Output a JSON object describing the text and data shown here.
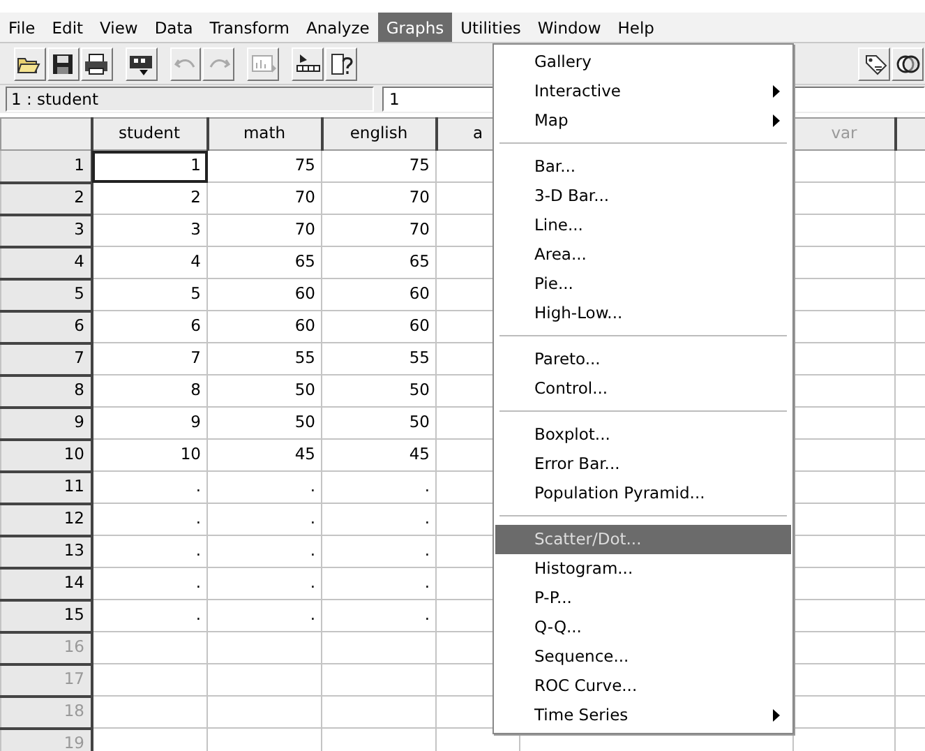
{
  "menubar": [
    {
      "label": "File",
      "selected": false
    },
    {
      "label": "Edit",
      "selected": false
    },
    {
      "label": "View",
      "selected": false
    },
    {
      "label": "Data",
      "selected": false
    },
    {
      "label": "Transform",
      "selected": false
    },
    {
      "label": "Analyze",
      "selected": false
    },
    {
      "label": "Graphs",
      "selected": true
    },
    {
      "label": "Utilities",
      "selected": false
    },
    {
      "label": "Window",
      "selected": false
    },
    {
      "label": "Help",
      "selected": false
    }
  ],
  "toolbar": [
    {
      "kind": "open",
      "disabled": false
    },
    {
      "kind": "save",
      "disabled": false
    },
    {
      "kind": "print",
      "disabled": false
    },
    {
      "kind": "dialog",
      "disabled": false
    },
    {
      "kind": "undo",
      "disabled": true
    },
    {
      "kind": "redo",
      "disabled": true
    },
    {
      "kind": "chart",
      "disabled": true
    },
    {
      "kind": "insert",
      "disabled": false
    },
    {
      "kind": "help",
      "disabled": false
    },
    {
      "kind": "tag",
      "disabled": false
    },
    {
      "kind": "circles",
      "disabled": false
    }
  ],
  "cell_editor": {
    "cell": "1 : student",
    "value": "1"
  },
  "grid": {
    "columns": [
      {
        "label": "student",
        "defined": true
      },
      {
        "label": "math",
        "defined": true
      },
      {
        "label": "english",
        "defined": true
      },
      {
        "label": "a",
        "defined": true
      },
      {
        "label": "var",
        "defined": false
      }
    ],
    "rows": [
      {
        "number": "1",
        "in_use": true,
        "cells": [
          {
            "text": "1",
            "selected": true
          },
          {
            "text": "75",
            "selected": false
          },
          {
            "text": "75",
            "selected": false
          }
        ]
      },
      {
        "number": "2",
        "in_use": true,
        "cells": [
          {
            "text": "2",
            "selected": false
          },
          {
            "text": "70",
            "selected": false
          },
          {
            "text": "70",
            "selected": false
          }
        ]
      },
      {
        "number": "3",
        "in_use": true,
        "cells": [
          {
            "text": "3",
            "selected": false
          },
          {
            "text": "70",
            "selected": false
          },
          {
            "text": "70",
            "selected": false
          }
        ]
      },
      {
        "number": "4",
        "in_use": true,
        "cells": [
          {
            "text": "4",
            "selected": false
          },
          {
            "text": "65",
            "selected": false
          },
          {
            "text": "65",
            "selected": false
          }
        ]
      },
      {
        "number": "5",
        "in_use": true,
        "cells": [
          {
            "text": "5",
            "selected": false
          },
          {
            "text": "60",
            "selected": false
          },
          {
            "text": "60",
            "selected": false
          }
        ]
      },
      {
        "number": "6",
        "in_use": true,
        "cells": [
          {
            "text": "6",
            "selected": false
          },
          {
            "text": "60",
            "selected": false
          },
          {
            "text": "60",
            "selected": false
          }
        ]
      },
      {
        "number": "7",
        "in_use": true,
        "cells": [
          {
            "text": "7",
            "selected": false
          },
          {
            "text": "55",
            "selected": false
          },
          {
            "text": "55",
            "selected": false
          }
        ]
      },
      {
        "number": "8",
        "in_use": true,
        "cells": [
          {
            "text": "8",
            "selected": false
          },
          {
            "text": "50",
            "selected": false
          },
          {
            "text": "50",
            "selected": false
          }
        ]
      },
      {
        "number": "9",
        "in_use": true,
        "cells": [
          {
            "text": "9",
            "selected": false
          },
          {
            "text": "50",
            "selected": false
          },
          {
            "text": "50",
            "selected": false
          }
        ]
      },
      {
        "number": "10",
        "in_use": true,
        "cells": [
          {
            "text": "10",
            "selected": false
          },
          {
            "text": "45",
            "selected": false
          },
          {
            "text": "45",
            "selected": false
          }
        ]
      },
      {
        "number": "11",
        "in_use": true,
        "cells": [
          {
            "text": ".",
            "selected": false
          },
          {
            "text": ".",
            "selected": false
          },
          {
            "text": ".",
            "selected": false
          }
        ]
      },
      {
        "number": "12",
        "in_use": true,
        "cells": [
          {
            "text": ".",
            "selected": false
          },
          {
            "text": ".",
            "selected": false
          },
          {
            "text": ".",
            "selected": false
          }
        ]
      },
      {
        "number": "13",
        "in_use": true,
        "cells": [
          {
            "text": ".",
            "selected": false
          },
          {
            "text": ".",
            "selected": false
          },
          {
            "text": ".",
            "selected": false
          }
        ]
      },
      {
        "number": "14",
        "in_use": true,
        "cells": [
          {
            "text": ".",
            "selected": false
          },
          {
            "text": ".",
            "selected": false
          },
          {
            "text": ".",
            "selected": false
          }
        ]
      },
      {
        "number": "15",
        "in_use": true,
        "cells": [
          {
            "text": ".",
            "selected": false
          },
          {
            "text": ".",
            "selected": false
          },
          {
            "text": ".",
            "selected": false
          }
        ]
      },
      {
        "number": "16",
        "in_use": false
      },
      {
        "number": "17",
        "in_use": false
      },
      {
        "number": "18",
        "in_use": false
      },
      {
        "number": "19",
        "in_use": false
      }
    ]
  },
  "graphs_menu": [
    {
      "kind": "item",
      "label": "Gallery",
      "submenu": false,
      "selected": false
    },
    {
      "kind": "item",
      "label": "Interactive",
      "submenu": true,
      "selected": false
    },
    {
      "kind": "item",
      "label": "Map",
      "submenu": true,
      "selected": false
    },
    {
      "kind": "separator"
    },
    {
      "kind": "item",
      "label": "Bar...",
      "submenu": false,
      "selected": false
    },
    {
      "kind": "item",
      "label": "3-D Bar...",
      "submenu": false,
      "selected": false
    },
    {
      "kind": "item",
      "label": "Line...",
      "submenu": false,
      "selected": false
    },
    {
      "kind": "item",
      "label": "Area...",
      "submenu": false,
      "selected": false
    },
    {
      "kind": "item",
      "label": "Pie...",
      "submenu": false,
      "selected": false
    },
    {
      "kind": "item",
      "label": "High-Low...",
      "submenu": false,
      "selected": false
    },
    {
      "kind": "separator"
    },
    {
      "kind": "item",
      "label": "Pareto...",
      "submenu": false,
      "selected": false
    },
    {
      "kind": "item",
      "label": "Control...",
      "submenu": false,
      "selected": false
    },
    {
      "kind": "separator"
    },
    {
      "kind": "item",
      "label": "Boxplot...",
      "submenu": false,
      "selected": false
    },
    {
      "kind": "item",
      "label": "Error Bar...",
      "submenu": false,
      "selected": false
    },
    {
      "kind": "item",
      "label": "Population Pyramid...",
      "submenu": false,
      "selected": false
    },
    {
      "kind": "separator"
    },
    {
      "kind": "item",
      "label": "Scatter/Dot...",
      "submenu": false,
      "selected": true
    },
    {
      "kind": "item",
      "label": "Histogram...",
      "submenu": false,
      "selected": false
    },
    {
      "kind": "item",
      "label": "P-P...",
      "submenu": false,
      "selected": false
    },
    {
      "kind": "item",
      "label": "Q-Q...",
      "submenu": false,
      "selected": false
    },
    {
      "kind": "item",
      "label": "Sequence...",
      "submenu": false,
      "selected": false
    },
    {
      "kind": "item",
      "label": "ROC Curve...",
      "submenu": false,
      "selected": false
    },
    {
      "kind": "item",
      "label": "Time Series",
      "submenu": true,
      "selected": false
    }
  ]
}
